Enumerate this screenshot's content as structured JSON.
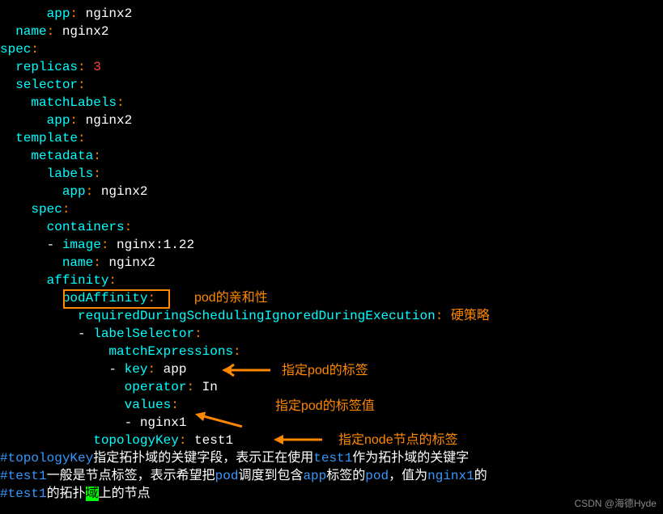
{
  "yaml": {
    "l1": {
      "indent": "      ",
      "key": "app",
      "val": "nginx2"
    },
    "l2": {
      "indent": "  ",
      "key": "name",
      "val": "nginx2"
    },
    "l3": {
      "indent": "",
      "key": "spec"
    },
    "l4": {
      "indent": "  ",
      "key": "replicas",
      "val": "3"
    },
    "l5": {
      "indent": "  ",
      "key": "selector"
    },
    "l6": {
      "indent": "    ",
      "key": "matchLabels"
    },
    "l7": {
      "indent": "      ",
      "key": "app",
      "val": "nginx2"
    },
    "l8": {
      "indent": "  ",
      "key": "template"
    },
    "l9": {
      "indent": "    ",
      "key": "metadata"
    },
    "l10": {
      "indent": "      ",
      "key": "labels"
    },
    "l11": {
      "indent": "        ",
      "key": "app",
      "val": "nginx2"
    },
    "l12": {
      "indent": "    ",
      "key": "spec"
    },
    "l13": {
      "indent": "      ",
      "key": "containers"
    },
    "l14": {
      "indent": "      - ",
      "key": "image",
      "val": "nginx:1.22"
    },
    "l15": {
      "indent": "        ",
      "key": "name",
      "val": "nginx2"
    },
    "l16": {
      "indent": "      ",
      "key": "affinity"
    },
    "l17": {
      "indent": "        ",
      "key": "podAffinity"
    },
    "l18": {
      "indent": "          ",
      "key": "requiredDuringSchedulingIgnoredDuringExecution"
    },
    "l19": {
      "indent": "          - ",
      "key": "labelSelector"
    },
    "l20": {
      "indent": "              ",
      "key": "matchExpressions"
    },
    "l21": {
      "indent": "              - ",
      "key": "key",
      "val": "app"
    },
    "l22": {
      "indent": "                ",
      "key": "operator",
      "val": "In"
    },
    "l23": {
      "indent": "                ",
      "key": "values"
    },
    "l24": {
      "indent": "                - ",
      "val": "nginx1"
    },
    "l25": {
      "indent": "            ",
      "key": "topologyKey",
      "val": "test1"
    }
  },
  "annotations": {
    "a1": "pod的亲和性",
    "a2": "硬策略",
    "a3": "指定pod的标签",
    "a4": "指定pod的标签值",
    "a5": "指定node节点的标签"
  },
  "comments": {
    "c1_before": "#topologyKey",
    "c1_mid1": "指定拓扑域的关键字段，表示正在使用",
    "c1_test1": "test1",
    "c1_after": "作为拓扑域的关键字",
    "c2_before": "#test1",
    "c2_mid1": "一般是节点标签，表示希望把",
    "c2_pod": "pod",
    "c2_mid2": "调度到包含",
    "c2_app": "app",
    "c2_mid3": "标签的",
    "c2_pod2": "pod",
    "c2_mid4": "，值为",
    "c2_nginx1": "nginx1",
    "c2_after": "的",
    "c3_before": "#test1",
    "c3_mid1": "的拓扑",
    "c3_yu": "域",
    "c3_after": "上的节点"
  },
  "watermark": "CSDN @海德Hyde"
}
